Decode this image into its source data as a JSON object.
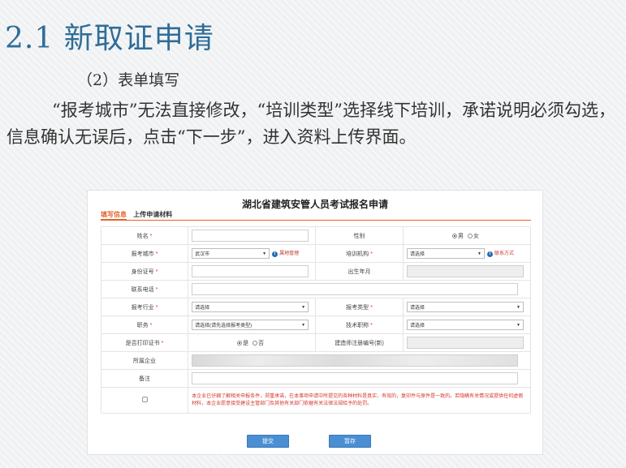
{
  "slide": {
    "title": "2.1 新取证申请",
    "subhead": "（2）表单填写",
    "paragraph": "“报考城市”无法直接修改，“培训类型”选择线下培训，承诺说明必须勾选，信息确认无误后，点击“下一步”，进入资料上传界面。"
  },
  "form": {
    "title": "湖北省建筑安管人员考试报名申请",
    "tabs": {
      "active": "填写信息",
      "next": "上传申请材料"
    },
    "required_mark": "*",
    "labels": {
      "name": "姓名",
      "gender": "性别",
      "city": "报考城市",
      "training": "培训机构",
      "id_number": "身份证号",
      "birth": "出生年月",
      "phone": "联系电话",
      "industry": "报考行业",
      "exam_type": "报考类型",
      "position": "职务",
      "tech_title": "技术职称",
      "print_cert": "是否打印证书",
      "constructor_no": "建造师注册编号(新)",
      "company": "所属企业",
      "remark": "备注"
    },
    "values": {
      "gender_male": "男",
      "gender_female": "女",
      "city": "武汉市",
      "city_link": "属地管理",
      "training": "请选择",
      "training_link": "联系方式",
      "industry": "请选择",
      "exam_type": "请选择",
      "position": "请选择(请先选择报考类型)",
      "tech_title": "请选择",
      "print_yes": "是",
      "print_no": "否"
    },
    "pledge": "本企业已仔细了解相关申报条件，郑重承诺，在本事项申请中所提交的各种材料是真实、有效的，复印件与原件是一致的。若隐瞒有关情况或提供任何虚假材料，本企业愿意接受建设主管部门及其他有关部门依据有关法律法规给予的处罚。",
    "buttons": {
      "submit": "提交",
      "save": "暂存"
    }
  },
  "colors": {
    "title_blue": "#2f6d98",
    "accent_orange": "#e2622a",
    "required_red": "#e03030",
    "button_blue": "#4a8fd3"
  }
}
